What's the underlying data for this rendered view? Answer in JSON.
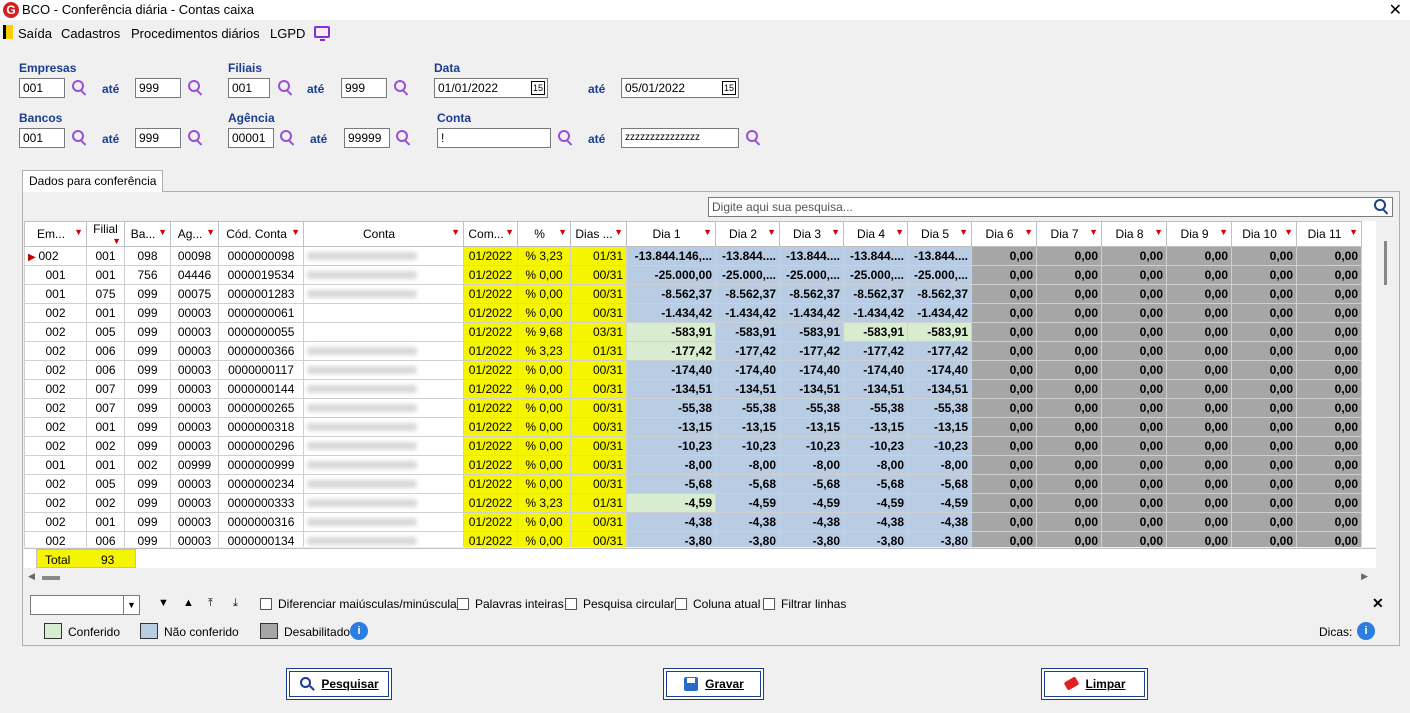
{
  "window": {
    "title": "BCO - Conferência diária - Contas caixa",
    "close": "✕"
  },
  "menu": {
    "items": [
      "Saída",
      "Cadastros",
      "Procedimentos diários",
      "LGPD"
    ]
  },
  "filters": {
    "empresas": {
      "label": "Empresas",
      "from": "001",
      "to": "999"
    },
    "filiais": {
      "label": "Filiais",
      "from": "001",
      "to": "999"
    },
    "data": {
      "label": "Data",
      "from": "01/01/2022",
      "to": "05/01/2022"
    },
    "bancos": {
      "label": "Bancos",
      "from": "001",
      "to": "999"
    },
    "agencia": {
      "label": "Agência",
      "from": "00001",
      "to": "99999"
    },
    "conta": {
      "label": "Conta",
      "from": "!",
      "to": "zzzzzzzzzzzzzzz"
    },
    "ate": "até"
  },
  "tab": {
    "label": "Dados para conferência"
  },
  "grid_search": {
    "placeholder": "Digite aqui sua pesquisa..."
  },
  "grid": {
    "headers": [
      "Em...",
      "Filial",
      "Ba...",
      "Ag...",
      "Cód. Conta",
      "Conta",
      "Com...",
      "%",
      "Dias ...",
      "Dia 1",
      "Dia 2",
      "Dia 3",
      "Dia 4",
      "Dia 5",
      "Dia 6",
      "Dia 7",
      "Dia 8",
      "Dia 9",
      "Dia 10",
      "Dia 11"
    ],
    "rows": [
      [
        "002",
        "001",
        "098",
        "00098",
        "0000000098",
        "01/2022",
        "% 3,23",
        "01/31",
        "-13.844.146,...",
        "-13.844....",
        "-13.844....",
        "-13.844....",
        "-13.844....",
        "0,00",
        "0,00",
        "0,00",
        "0,00",
        "0,00",
        "0,00"
      ],
      [
        "001",
        "001",
        "756",
        "04446",
        "0000019534",
        "01/2022",
        "% 0,00",
        "00/31",
        "-25.000,00",
        "-25.000,...",
        "-25.000,...",
        "-25.000,...",
        "-25.000,...",
        "0,00",
        "0,00",
        "0,00",
        "0,00",
        "0,00",
        "0,00"
      ],
      [
        "001",
        "075",
        "099",
        "00075",
        "0000001283",
        "01/2022",
        "% 0,00",
        "00/31",
        "-8.562,37",
        "-8.562,37",
        "-8.562,37",
        "-8.562,37",
        "-8.562,37",
        "0,00",
        "0,00",
        "0,00",
        "0,00",
        "0,00",
        "0,00"
      ],
      [
        "002",
        "001",
        "099",
        "00003",
        "0000000061",
        "01/2022",
        "% 0,00",
        "00/31",
        "-1.434,42",
        "-1.434,42",
        "-1.434,42",
        "-1.434,42",
        "-1.434,42",
        "0,00",
        "0,00",
        "0,00",
        "0,00",
        "0,00",
        "0,00"
      ],
      [
        "002",
        "005",
        "099",
        "00003",
        "0000000055",
        "01/2022",
        "% 9,68",
        "03/31",
        "-583,91",
        "-583,91",
        "-583,91",
        "-583,91",
        "-583,91",
        "0,00",
        "0,00",
        "0,00",
        "0,00",
        "0,00",
        "0,00"
      ],
      [
        "002",
        "006",
        "099",
        "00003",
        "0000000366",
        "01/2022",
        "% 3,23",
        "01/31",
        "-177,42",
        "-177,42",
        "-177,42",
        "-177,42",
        "-177,42",
        "0,00",
        "0,00",
        "0,00",
        "0,00",
        "0,00",
        "0,00"
      ],
      [
        "002",
        "006",
        "099",
        "00003",
        "0000000117",
        "01/2022",
        "% 0,00",
        "00/31",
        "-174,40",
        "-174,40",
        "-174,40",
        "-174,40",
        "-174,40",
        "0,00",
        "0,00",
        "0,00",
        "0,00",
        "0,00",
        "0,00"
      ],
      [
        "002",
        "007",
        "099",
        "00003",
        "0000000144",
        "01/2022",
        "% 0,00",
        "00/31",
        "-134,51",
        "-134,51",
        "-134,51",
        "-134,51",
        "-134,51",
        "0,00",
        "0,00",
        "0,00",
        "0,00",
        "0,00",
        "0,00"
      ],
      [
        "002",
        "007",
        "099",
        "00003",
        "0000000265",
        "01/2022",
        "% 0,00",
        "00/31",
        "-55,38",
        "-55,38",
        "-55,38",
        "-55,38",
        "-55,38",
        "0,00",
        "0,00",
        "0,00",
        "0,00",
        "0,00",
        "0,00"
      ],
      [
        "002",
        "001",
        "099",
        "00003",
        "0000000318",
        "01/2022",
        "% 0,00",
        "00/31",
        "-13,15",
        "-13,15",
        "-13,15",
        "-13,15",
        "-13,15",
        "0,00",
        "0,00",
        "0,00",
        "0,00",
        "0,00",
        "0,00"
      ],
      [
        "002",
        "002",
        "099",
        "00003",
        "0000000296",
        "01/2022",
        "% 0,00",
        "00/31",
        "-10,23",
        "-10,23",
        "-10,23",
        "-10,23",
        "-10,23",
        "0,00",
        "0,00",
        "0,00",
        "0,00",
        "0,00",
        "0,00"
      ],
      [
        "001",
        "001",
        "002",
        "00999",
        "0000000999",
        "01/2022",
        "% 0,00",
        "00/31",
        "-8,00",
        "-8,00",
        "-8,00",
        "-8,00",
        "-8,00",
        "0,00",
        "0,00",
        "0,00",
        "0,00",
        "0,00",
        "0,00"
      ],
      [
        "002",
        "005",
        "099",
        "00003",
        "0000000234",
        "01/2022",
        "% 0,00",
        "00/31",
        "-5,68",
        "-5,68",
        "-5,68",
        "-5,68",
        "-5,68",
        "0,00",
        "0,00",
        "0,00",
        "0,00",
        "0,00",
        "0,00"
      ],
      [
        "002",
        "002",
        "099",
        "00003",
        "0000000333",
        "01/2022",
        "% 3,23",
        "01/31",
        "-4,59",
        "-4,59",
        "-4,59",
        "-4,59",
        "-4,59",
        "0,00",
        "0,00",
        "0,00",
        "0,00",
        "0,00",
        "0,00"
      ],
      [
        "002",
        "001",
        "099",
        "00003",
        "0000000316",
        "01/2022",
        "% 0,00",
        "00/31",
        "-4,38",
        "-4,38",
        "-4,38",
        "-4,38",
        "-4,38",
        "0,00",
        "0,00",
        "0,00",
        "0,00",
        "0,00",
        "0,00"
      ],
      [
        "002",
        "006",
        "099",
        "00003",
        "0000000134",
        "01/2022",
        "% 0,00",
        "00/31",
        "-3,80",
        "-3,80",
        "-3,80",
        "-3,80",
        "-3,80",
        "0,00",
        "0,00",
        "0,00",
        "0,00",
        "0,00",
        "0,00"
      ]
    ],
    "green_cells": [
      [
        4,
        0
      ],
      [
        4,
        3
      ],
      [
        4,
        4
      ],
      [
        5,
        0
      ],
      [
        13,
        0
      ]
    ],
    "total": {
      "label": "Total",
      "value": "93"
    }
  },
  "search_toolbar": {
    "options": [
      "Diferenciar maiúsculas/minúsculas",
      "Palavras inteiras",
      "Pesquisa circular",
      "Coluna atual",
      "Filtrar linhas"
    ]
  },
  "legend": {
    "items": [
      {
        "label": "Conferido",
        "color": "#d8ecd0"
      },
      {
        "label": "Não conferido",
        "color": "#b8cce4"
      },
      {
        "label": "Desabilitado",
        "color": "#a6a6a6"
      }
    ],
    "dicas": "Dicas:"
  },
  "buttons": {
    "pesquisar": "Pesquisar",
    "gravar": "Gravar",
    "limpar": "Limpar"
  }
}
